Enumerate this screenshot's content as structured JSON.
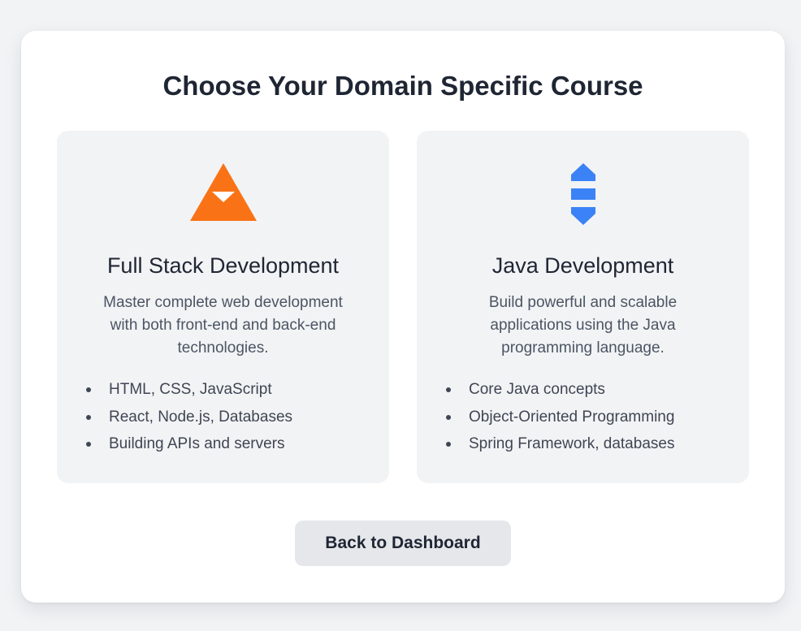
{
  "page": {
    "title": "Choose Your Domain Specific Course"
  },
  "courses": [
    {
      "icon": "stack-triangle-icon",
      "icon_color": "#f97316",
      "title": "Full Stack Development",
      "description": "Master complete web development with both front-end and back-end technologies.",
      "topics": [
        "HTML, CSS, JavaScript",
        "React, Node.js, Databases",
        "Building APIs and servers"
      ]
    },
    {
      "icon": "java-arrows-icon",
      "icon_color": "#3b82f6",
      "title": "Java Development",
      "description": "Build powerful and scalable applications using the Java programming language.",
      "topics": [
        "Core Java concepts",
        "Object-Oriented Programming",
        "Spring Framework, databases"
      ]
    }
  ],
  "actions": {
    "back_label": "Back to Dashboard"
  },
  "colors": {
    "background": "#f2f3f5",
    "panel": "#ffffff",
    "card": "#f2f3f5",
    "button": "#e5e7eb",
    "text": "#1f2633"
  }
}
